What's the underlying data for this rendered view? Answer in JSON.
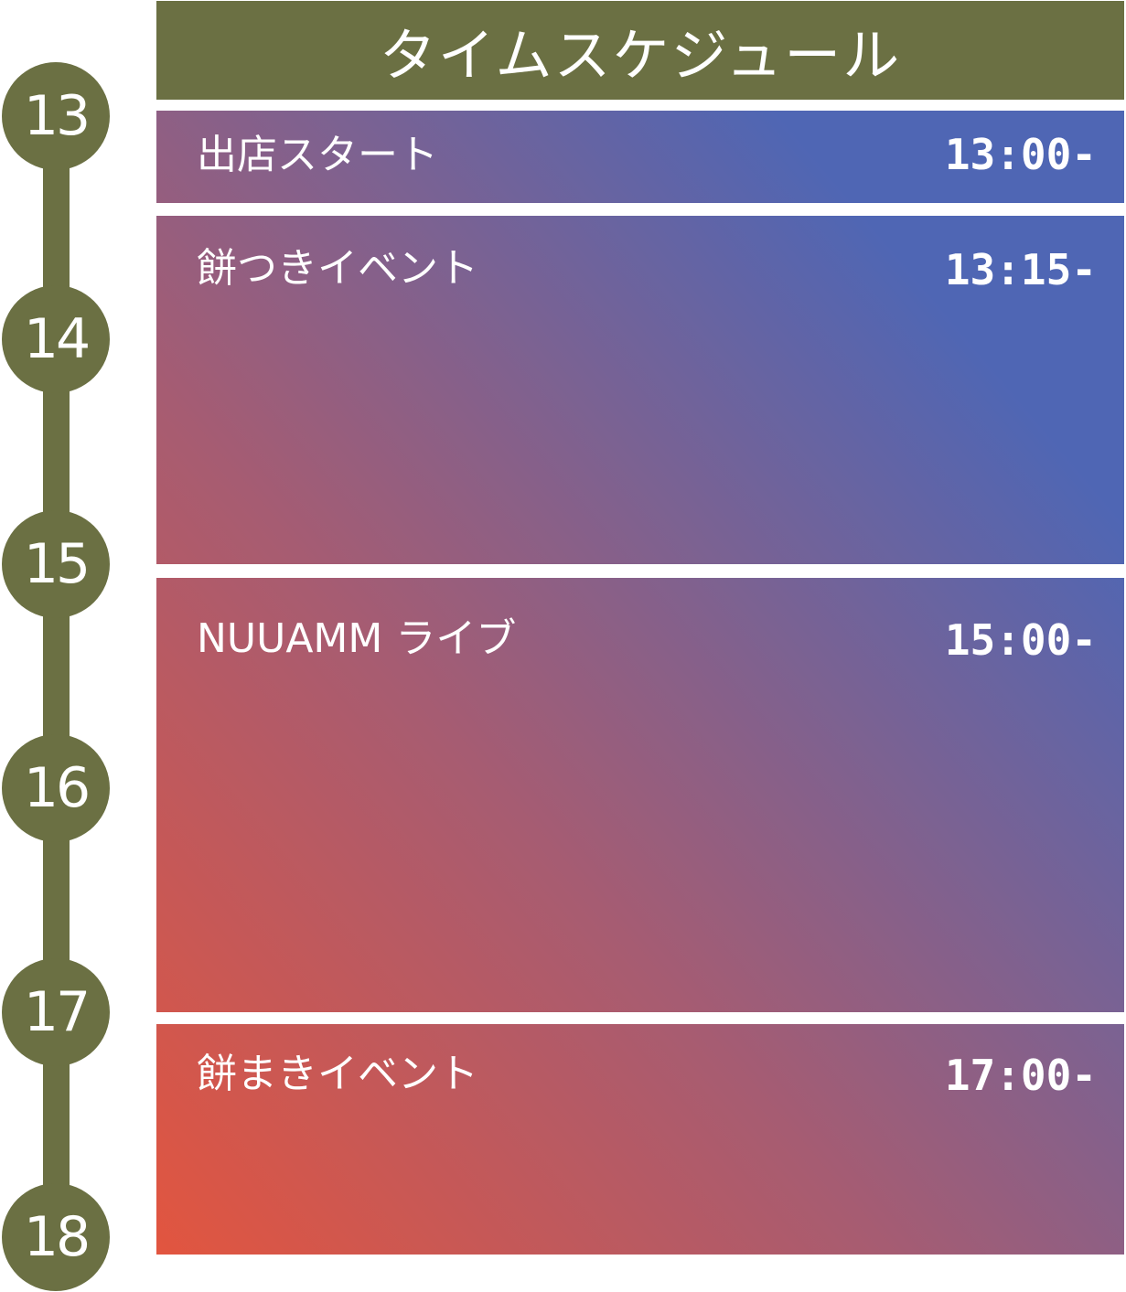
{
  "header": {
    "title": "タイムスケジュール"
  },
  "timeline": {
    "hours": [
      "13",
      "14",
      "15",
      "16",
      "17",
      "18"
    ]
  },
  "events": [
    {
      "title": "出店スタート",
      "time": "13:00-"
    },
    {
      "title": "餅つきイベント",
      "time": "13:15-"
    },
    {
      "title": "NUUAMM ライブ",
      "time": "15:00-"
    },
    {
      "title": "餅まきイベント",
      "time": "17:00-"
    }
  ],
  "colors": {
    "olive": "#6b7043",
    "gradient_red": "#e2553f",
    "gradient_blue": "#4f66b4",
    "text": "#ffffff"
  }
}
